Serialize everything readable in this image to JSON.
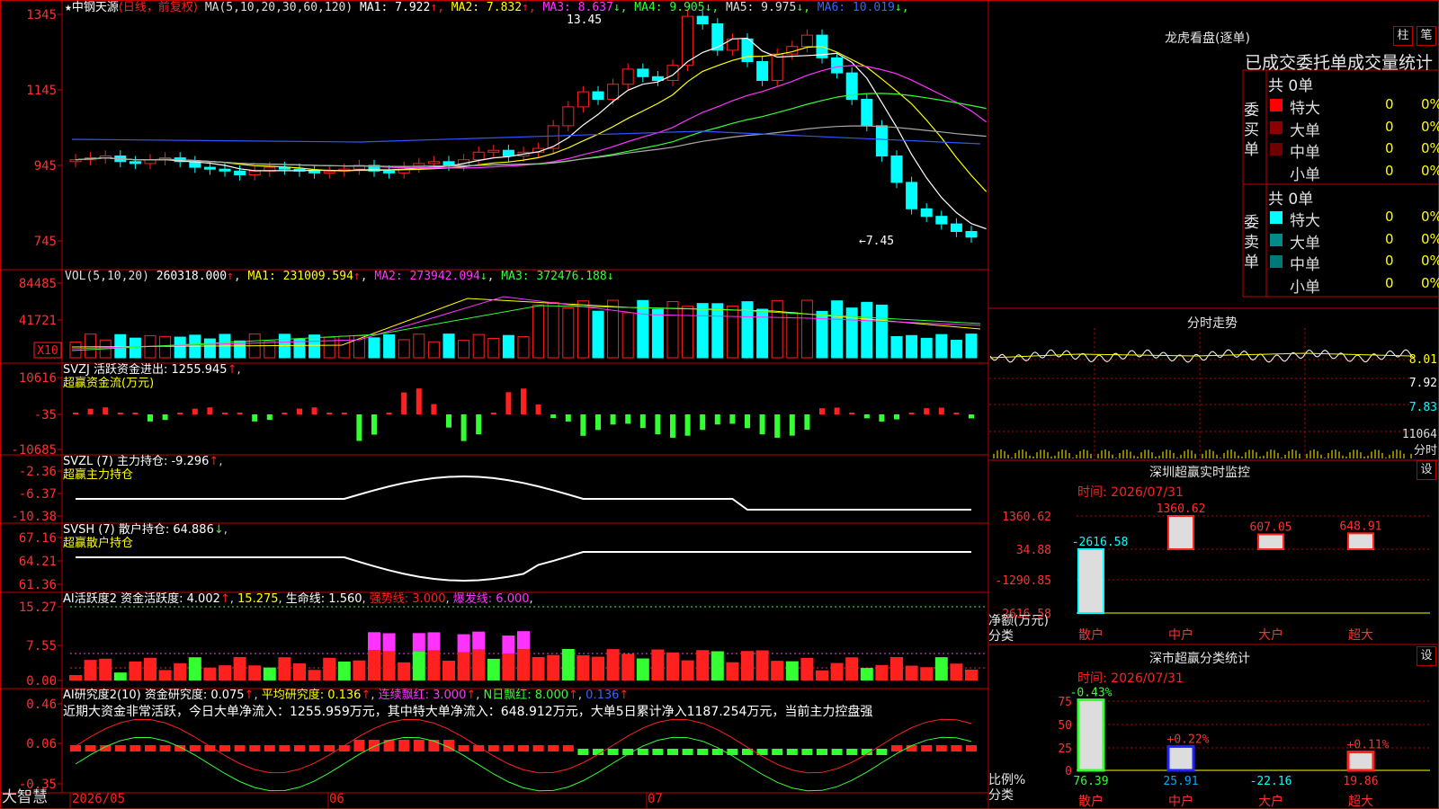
{
  "app": {
    "brand": "大智慧"
  },
  "kline": {
    "star": "★",
    "stock_name": "中钢天源",
    "period_mode": "(日线，前复权)",
    "ma_spec": "MA(5,10,20,30,60,120)",
    "ma_values": [
      {
        "label": "MA1: 7.922",
        "arrow": "↑",
        "color": "#ffffff"
      },
      {
        "label": "MA2: 7.832",
        "arrow": "↑",
        "color": "#ffff00"
      },
      {
        "label": "MA3: 8.637",
        "arrow": "↓",
        "color": "#ff33ff"
      },
      {
        "label": "MA4: 9.905",
        "arrow": "↓",
        "color": "#33ff33"
      },
      {
        "label": "MA5: 9.975",
        "arrow": "↓",
        "color": "#dddddd"
      },
      {
        "label": "MA6: 10.019",
        "arrow": "↓",
        "color": "#3366ff"
      }
    ],
    "yaxis": [
      "1345",
      "1145",
      "945",
      "745"
    ],
    "high_mark": "13.45",
    "low_mark": "←7.45"
  },
  "vol": {
    "title": "VOL(5,10,20)",
    "value": "260318.000",
    "ma1": "MA1: 231009.594",
    "ma2": "MA2: 273942.094",
    "ma3": "MA3: 372476.188",
    "yaxis": [
      "84485",
      "41721"
    ],
    "unit": "X10"
  },
  "svzj": {
    "title": "SVZJ  活跃资金进出: 1255.945",
    "subtitle": "超赢资金流(万元)",
    "yaxis": [
      "10616",
      "-35",
      "-10685"
    ]
  },
  "svzl": {
    "title": "SVZL (7) 主力持仓: -9.296",
    "subtitle": "超赢主力持仓",
    "yaxis": [
      "-2.36",
      "-6.37",
      "-10.38"
    ]
  },
  "svsh": {
    "title": "SVSH (7) 散户持仓: 64.886",
    "subtitle": "超赢散户持仓",
    "yaxis": [
      "67.16",
      "64.21",
      "61.36"
    ]
  },
  "ai1": {
    "title": "AI活跃度2 资金活跃度: 4.002",
    "v2": "15.275",
    "v3": "生命线: 1.560",
    "v4": "强势线: 3.000",
    "v5": "爆发线: 6.000",
    "yaxis": [
      "15.27",
      "7.55",
      "0.00"
    ]
  },
  "ai2": {
    "title": "AI研究度2(10) 资金研究度: 0.075",
    "v2": "平均研究度: 0.136",
    "v3": "连续飘红: 3.000",
    "v4": "N日飘红: 8.000",
    "v5": "0.136",
    "comment": "近期大资金非常活跃，今日大单净流入：1255.959万元，其中特大单净流入：648.912万元，大单5日累计净入1187.254万元，当前主力控盘强",
    "yaxis": [
      "0.46",
      "0.06",
      "-0.35"
    ]
  },
  "xaxis": [
    "2026/05",
    "06",
    "07"
  ],
  "longhu": {
    "title": "龙虎看盘(逐单)",
    "btn1": "柱",
    "btn2": "笔",
    "subtitle": "已成交委托单成交量统计",
    "buy_label": "委买单",
    "sell_label": "委卖单",
    "buy_total": "共 0单",
    "sell_total": "共 0单",
    "buy_rows": [
      {
        "name": "特大",
        "v1": "0",
        "v2": "0%",
        "color": "#ff0000"
      },
      {
        "name": "大单",
        "v1": "0",
        "v2": "0%",
        "color": "#8b0000"
      },
      {
        "name": "中单",
        "v1": "0",
        "v2": "0%",
        "color": "#700000"
      },
      {
        "name": "小单",
        "v1": "0",
        "v2": "0%",
        "color": "#000000"
      }
    ],
    "sell_rows": [
      {
        "name": "特大",
        "v1": "0",
        "v2": "0%",
        "color": "#00ffff"
      },
      {
        "name": "大单",
        "v1": "0",
        "v2": "0%",
        "color": "#008b8b"
      },
      {
        "name": "中单",
        "v1": "0",
        "v2": "0%",
        "color": "#007878"
      },
      {
        "name": "小单",
        "v1": "0",
        "v2": "0%",
        "color": "#000000"
      }
    ]
  },
  "fenshi": {
    "title": "分时走势",
    "prices": [
      "8.01",
      "7.92",
      "7.83"
    ],
    "vol": "11064",
    "label": "分时"
  },
  "sz_monitor": {
    "title": "深圳超赢实时监控",
    "btn": "设",
    "time": "时间: 2026/07/31",
    "yaxis": [
      "1360.62",
      "34.88",
      "-1290.85",
      "-2616.58"
    ],
    "ylabel": "净额(万元)",
    "xlabel": "分类",
    "chart_data": {
      "type": "bar",
      "categories": [
        "散户",
        "中户",
        "大户",
        "超大"
      ],
      "values": [
        -2616.58,
        1360.62,
        607.05,
        648.91
      ],
      "value_labels": [
        "-2616.58",
        "1360.62",
        "607.05",
        "648.91"
      ],
      "ylim": [
        -2616.58,
        1360.62
      ]
    }
  },
  "sz_class": {
    "title": "深市超赢分类统计",
    "btn": "设",
    "time": "时间: 2026/07/31",
    "yaxis": [
      "75",
      "50",
      "25",
      "0"
    ],
    "ylabel": "比例%",
    "xlabel": "分类",
    "chart_data": {
      "type": "bar",
      "categories": [
        "散户",
        "中户",
        "大户",
        "超大"
      ],
      "values": [
        76.39,
        25.91,
        -22.16,
        19.86
      ],
      "value_labels": [
        "76.39",
        "25.91",
        "-22.16",
        "19.86"
      ],
      "pct_labels": [
        "-0.43%",
        "+0.22%",
        "",
        "+0.11%"
      ],
      "ylim": [
        0,
        75
      ]
    }
  },
  "colors": {
    "up": "#ff2020",
    "down": "#00ffff",
    "grid": "#b00000"
  }
}
